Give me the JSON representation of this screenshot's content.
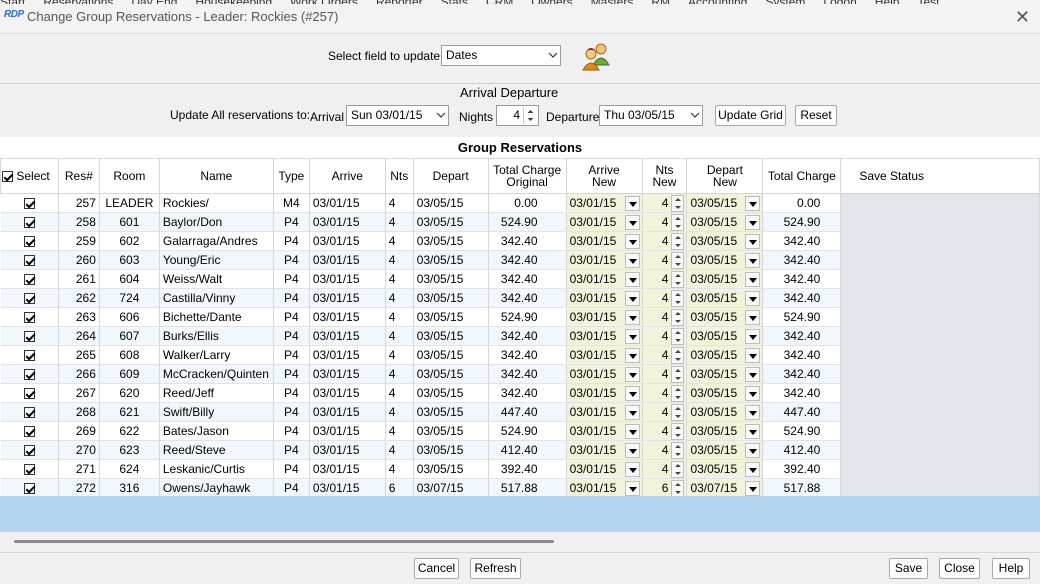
{
  "window": {
    "logo": "RDP",
    "title": "Change Group Reservations - Leader: Rockies (#257)"
  },
  "menu": [
    "Start",
    "Reservations",
    "Day End",
    "Housekeeping",
    "Work Orders",
    "Reporter",
    "Stats",
    "CRM",
    "Owners",
    "Masters",
    "RM",
    "Accounting",
    "System",
    "Logon",
    "Help",
    "Test"
  ],
  "field_select": {
    "label": "Select field to update:",
    "value": "Dates"
  },
  "update_all": {
    "header": "Arrival Departure",
    "label": "Update All reservations to:",
    "arrival_label": "Arrival",
    "arrival_value": "Sun 03/01/15",
    "nights_label": "Nights",
    "nights_value": "4",
    "departure_label": "Departure",
    "departure_value": "Thu 03/05/15",
    "update_grid": "Update Grid",
    "reset": "Reset"
  },
  "grid": {
    "title": "Group Reservations",
    "headers": {
      "select": "Select",
      "res": "Res#",
      "room": "Room",
      "name": "Name",
      "type": "Type",
      "arrive": "Arrive",
      "nts": "Nts",
      "depart": "Depart",
      "tco1": "Total Charge",
      "tco2": "Original",
      "an1": "Arrive",
      "an2": "New",
      "nn1": "Nts",
      "nn2": "New",
      "dn1": "Depart",
      "dn2": "New",
      "tc": "Total Charge",
      "status": "Save Status"
    },
    "rows": [
      {
        "res": "257",
        "room": "LEADER",
        "name": "Rockies/",
        "type": "M4",
        "arrive": "03/01/15",
        "nts": "4",
        "depart": "03/05/15",
        "tco": "0.00",
        "an": "03/01/15",
        "nn": "4",
        "dn": "03/05/15",
        "tc": "0.00"
      },
      {
        "res": "258",
        "room": "601",
        "name": "Baylor/Don",
        "type": "P4",
        "arrive": "03/01/15",
        "nts": "4",
        "depart": "03/05/15",
        "tco": "524.90",
        "an": "03/01/15",
        "nn": "4",
        "dn": "03/05/15",
        "tc": "524.90"
      },
      {
        "res": "259",
        "room": "602",
        "name": "Galarraga/Andres",
        "type": "P4",
        "arrive": "03/01/15",
        "nts": "4",
        "depart": "03/05/15",
        "tco": "342.40",
        "an": "03/01/15",
        "nn": "4",
        "dn": "03/05/15",
        "tc": "342.40"
      },
      {
        "res": "260",
        "room": "603",
        "name": "Young/Eric",
        "type": "P4",
        "arrive": "03/01/15",
        "nts": "4",
        "depart": "03/05/15",
        "tco": "342.40",
        "an": "03/01/15",
        "nn": "4",
        "dn": "03/05/15",
        "tc": "342.40"
      },
      {
        "res": "261",
        "room": "604",
        "name": "Weiss/Walt",
        "type": "P4",
        "arrive": "03/01/15",
        "nts": "4",
        "depart": "03/05/15",
        "tco": "342.40",
        "an": "03/01/15",
        "nn": "4",
        "dn": "03/05/15",
        "tc": "342.40"
      },
      {
        "res": "262",
        "room": "724",
        "name": "Castilla/Vinny",
        "type": "P4",
        "arrive": "03/01/15",
        "nts": "4",
        "depart": "03/05/15",
        "tco": "342.40",
        "an": "03/01/15",
        "nn": "4",
        "dn": "03/05/15",
        "tc": "342.40"
      },
      {
        "res": "263",
        "room": "606",
        "name": "Bichette/Dante",
        "type": "P4",
        "arrive": "03/01/15",
        "nts": "4",
        "depart": "03/05/15",
        "tco": "524.90",
        "an": "03/01/15",
        "nn": "4",
        "dn": "03/05/15",
        "tc": "524.90"
      },
      {
        "res": "264",
        "room": "607",
        "name": "Burks/Ellis",
        "type": "P4",
        "arrive": "03/01/15",
        "nts": "4",
        "depart": "03/05/15",
        "tco": "342.40",
        "an": "03/01/15",
        "nn": "4",
        "dn": "03/05/15",
        "tc": "342.40"
      },
      {
        "res": "265",
        "room": "608",
        "name": "Walker/Larry",
        "type": "P4",
        "arrive": "03/01/15",
        "nts": "4",
        "depart": "03/05/15",
        "tco": "342.40",
        "an": "03/01/15",
        "nn": "4",
        "dn": "03/05/15",
        "tc": "342.40"
      },
      {
        "res": "266",
        "room": "609",
        "name": "McCracken/Quinten",
        "type": "P4",
        "arrive": "03/01/15",
        "nts": "4",
        "depart": "03/05/15",
        "tco": "342.40",
        "an": "03/01/15",
        "nn": "4",
        "dn": "03/05/15",
        "tc": "342.40"
      },
      {
        "res": "267",
        "room": "620",
        "name": "Reed/Jeff",
        "type": "P4",
        "arrive": "03/01/15",
        "nts": "4",
        "depart": "03/05/15",
        "tco": "342.40",
        "an": "03/01/15",
        "nn": "4",
        "dn": "03/05/15",
        "tc": "342.40"
      },
      {
        "res": "268",
        "room": "621",
        "name": "Swift/Billy",
        "type": "P4",
        "arrive": "03/01/15",
        "nts": "4",
        "depart": "03/05/15",
        "tco": "447.40",
        "an": "03/01/15",
        "nn": "4",
        "dn": "03/05/15",
        "tc": "447.40"
      },
      {
        "res": "269",
        "room": "622",
        "name": "Bates/Jason",
        "type": "P4",
        "arrive": "03/01/15",
        "nts": "4",
        "depart": "03/05/15",
        "tco": "524.90",
        "an": "03/01/15",
        "nn": "4",
        "dn": "03/05/15",
        "tc": "524.90"
      },
      {
        "res": "270",
        "room": "623",
        "name": "Reed/Steve",
        "type": "P4",
        "arrive": "03/01/15",
        "nts": "4",
        "depart": "03/05/15",
        "tco": "412.40",
        "an": "03/01/15",
        "nn": "4",
        "dn": "03/05/15",
        "tc": "412.40"
      },
      {
        "res": "271",
        "room": "624",
        "name": "Leskanic/Curtis",
        "type": "P4",
        "arrive": "03/01/15",
        "nts": "4",
        "depart": "03/05/15",
        "tco": "392.40",
        "an": "03/01/15",
        "nn": "4",
        "dn": "03/05/15",
        "tc": "392.40"
      },
      {
        "res": "272",
        "room": "316",
        "name": "Owens/Jayhawk",
        "type": "P4",
        "arrive": "03/01/15",
        "nts": "6",
        "depart": "03/07/15",
        "tco": "517.88",
        "an": "03/01/15",
        "nn": "6",
        "dn": "03/07/15",
        "tc": "517.88"
      }
    ]
  },
  "footer": {
    "cancel": "Cancel",
    "refresh": "Refresh",
    "save": "Save",
    "close": "Close",
    "help": "Help"
  }
}
